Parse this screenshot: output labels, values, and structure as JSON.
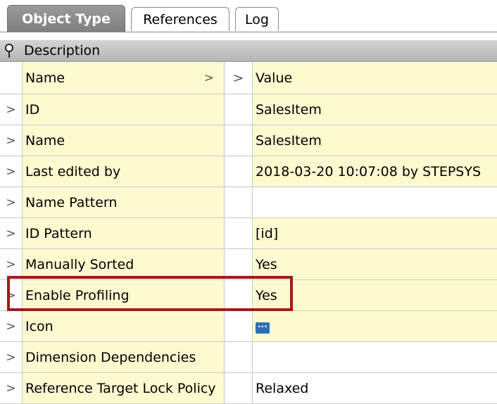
{
  "tabs": [
    {
      "label": "Object Type",
      "active": true
    },
    {
      "label": "References",
      "active": false
    },
    {
      "label": "Log",
      "active": false
    }
  ],
  "section": {
    "title": "Description",
    "icon": "pin-icon"
  },
  "columns": {
    "name": "Name",
    "value": "Value",
    "chevron": ">"
  },
  "rows": [
    {
      "name": "ID",
      "value": "SalesItem"
    },
    {
      "name": "Name",
      "value": "SalesItem"
    },
    {
      "name": "Last edited by",
      "value": "2018-03-20 10:07:08 by STEPSYS"
    },
    {
      "name": "Name Pattern",
      "value": ""
    },
    {
      "name": "ID Pattern",
      "value": "[id]"
    },
    {
      "name": "Manually Sorted",
      "value": "Yes"
    },
    {
      "name": "Enable Profiling",
      "value": "Yes",
      "highlighted": true
    },
    {
      "name": "Icon",
      "value": "",
      "icon": "object-type-icon"
    },
    {
      "name": "Dimension Dependencies",
      "value": ""
    },
    {
      "name": "Reference Target Lock Policy",
      "value": "Relaxed"
    }
  ],
  "row_chevron": ">",
  "colors": {
    "highlight_border": "#a01c1c",
    "cell_fill": "#fdfad0",
    "icon_blue": "#2c6fb5"
  }
}
